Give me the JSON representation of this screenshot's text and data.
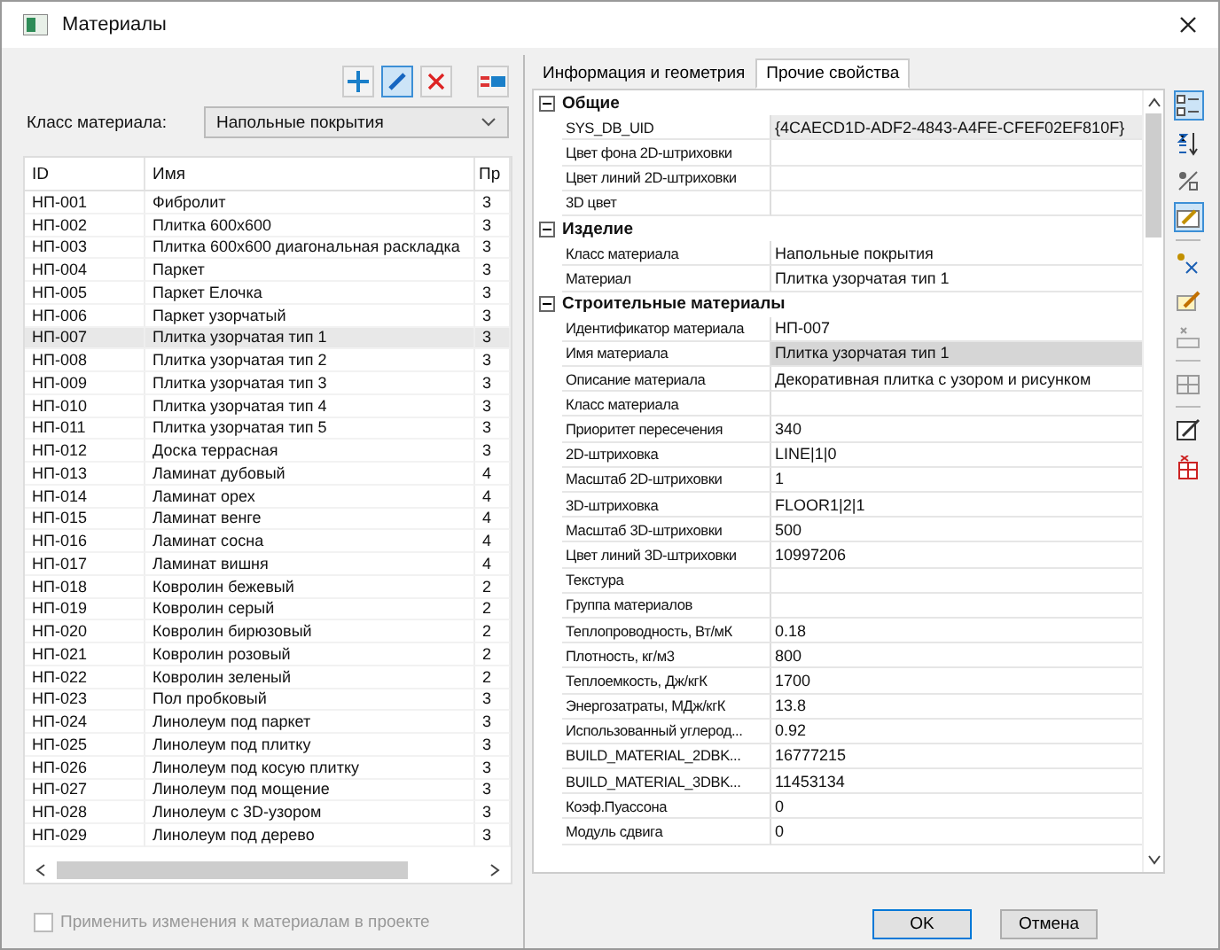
{
  "window": {
    "title": "Материалы"
  },
  "toolbar": [
    {
      "kind": "add",
      "pressed": false
    },
    {
      "kind": "edit",
      "pressed": true
    },
    {
      "kind": "delete",
      "pressed": false
    },
    {
      "kind": "assign",
      "pressed": false
    }
  ],
  "class_filter": {
    "label": "Класс материала:",
    "value": "Напольные покрытия"
  },
  "table": {
    "columns": [
      "ID",
      "Имя",
      "Пр"
    ],
    "rows": [
      {
        "id": "НП-001",
        "name": "Фибролит",
        "column_3": "3",
        "selected": false
      },
      {
        "id": "НП-002",
        "name": "Плитка 600х600",
        "column_3": "3",
        "selected": false
      },
      {
        "id": "НП-003",
        "name": "Плитка 600х600 диагональная раскладка",
        "column_3": "3",
        "selected": false
      },
      {
        "id": "НП-004",
        "name": "Паркет",
        "column_3": "3",
        "selected": false
      },
      {
        "id": "НП-005",
        "name": "Паркет Елочка",
        "column_3": "3",
        "selected": false
      },
      {
        "id": "НП-006",
        "name": "Паркет узорчатый",
        "column_3": "3",
        "selected": false
      },
      {
        "id": "НП-007",
        "name": "Плитка узорчатая тип 1",
        "column_3": "3",
        "selected": true
      },
      {
        "id": "НП-008",
        "name": "Плитка узорчатая тип 2",
        "column_3": "3",
        "selected": false
      },
      {
        "id": "НП-009",
        "name": "Плитка узорчатая тип 3",
        "column_3": "3",
        "selected": false
      },
      {
        "id": "НП-010",
        "name": "Плитка узорчатая тип 4",
        "column_3": "3",
        "selected": false
      },
      {
        "id": "НП-011",
        "name": "Плитка узорчатая тип 5",
        "column_3": "3",
        "selected": false
      },
      {
        "id": "НП-012",
        "name": "Доска террасная",
        "column_3": "3",
        "selected": false
      },
      {
        "id": "НП-013",
        "name": "Ламинат дубовый",
        "column_3": "4",
        "selected": false
      },
      {
        "id": "НП-014",
        "name": "Ламинат орех",
        "column_3": "4",
        "selected": false
      },
      {
        "id": "НП-015",
        "name": "Ламинат венге",
        "column_3": "4",
        "selected": false
      },
      {
        "id": "НП-016",
        "name": "Ламинат сосна",
        "column_3": "4",
        "selected": false
      },
      {
        "id": "НП-017",
        "name": "Ламинат вишня",
        "column_3": "4",
        "selected": false
      },
      {
        "id": "НП-018",
        "name": "Ковролин бежевый",
        "column_3": "2",
        "selected": false
      },
      {
        "id": "НП-019",
        "name": "Ковролин серый",
        "column_3": "2",
        "selected": false
      },
      {
        "id": "НП-020",
        "name": "Ковролин бирюзовый",
        "column_3": "2",
        "selected": false
      },
      {
        "id": "НП-021",
        "name": "Ковролин розовый",
        "column_3": "2",
        "selected": false
      },
      {
        "id": "НП-022",
        "name": "Ковролин зеленый",
        "column_3": "2",
        "selected": false
      },
      {
        "id": "НП-023",
        "name": "Пол пробковый",
        "column_3": "3",
        "selected": false
      },
      {
        "id": "НП-024",
        "name": "Линолеум под паркет",
        "column_3": "3",
        "selected": false
      },
      {
        "id": "НП-025",
        "name": "Линолеум под плитку",
        "column_3": "3",
        "selected": false
      },
      {
        "id": "НП-026",
        "name": "Линолеум под косую плитку",
        "column_3": "3",
        "selected": false
      },
      {
        "id": "НП-027",
        "name": "Линолеум под мощение",
        "column_3": "3",
        "selected": false
      },
      {
        "id": "НП-028",
        "name": "Линолеум с 3D-узором",
        "column_3": "3",
        "selected": false
      },
      {
        "id": "НП-029",
        "name": "Линолеум под дерево",
        "column_3": "3",
        "selected": false
      }
    ]
  },
  "apply_checkbox": {
    "label": "Применить изменения к материалам в проекте",
    "checked": false,
    "disabled": true
  },
  "tabs": [
    {
      "label": "Информация и геометрия",
      "selected": false
    },
    {
      "label": "Прочие свойства",
      "selected": true
    }
  ],
  "property_groups": [
    {
      "title": "Общие",
      "expanded": true,
      "rows": [
        {
          "name": "SYS_DB_UID",
          "value": "{4CAECD1D-ADF2-4843-A4FE-CFEF02EF810F}",
          "readonly": true,
          "selected": false
        },
        {
          "name": "Цвет фона 2D-штриховки",
          "value": "",
          "readonly": false,
          "selected": false
        },
        {
          "name": "Цвет  линий 2D-штриховки",
          "value": "",
          "readonly": false,
          "selected": false
        },
        {
          "name": "3D цвет",
          "value": "",
          "readonly": false,
          "selected": false
        }
      ]
    },
    {
      "title": "Изделие",
      "expanded": true,
      "rows": [
        {
          "name": "Класс материала",
          "value": "Напольные покрытия",
          "readonly": false,
          "selected": false
        },
        {
          "name": "Материал",
          "value": "Плитка узорчатая тип 1",
          "readonly": false,
          "selected": false
        }
      ]
    },
    {
      "title": "Строительные материалы",
      "expanded": true,
      "rows": [
        {
          "name": "Идентификатор материала",
          "value": "НП-007",
          "readonly": false,
          "selected": false
        },
        {
          "name": "Имя материала",
          "value": "Плитка узорчатая тип 1",
          "readonly": false,
          "selected": true
        },
        {
          "name": "Описание материала",
          "value": "Декоративная плитка с узором и рисунком",
          "readonly": false,
          "selected": false
        },
        {
          "name": "Класс материала",
          "value": "",
          "readonly": false,
          "selected": false
        },
        {
          "name": "Приоритет пересечения",
          "value": "340",
          "readonly": false,
          "selected": false
        },
        {
          "name": "2D-штриховка",
          "value": "LINE|1|0",
          "readonly": false,
          "selected": false
        },
        {
          "name": "Масштаб 2D-штриховки",
          "value": "1",
          "readonly": false,
          "selected": false
        },
        {
          "name": "3D-штриховка",
          "value": "FLOOR1|2|1",
          "readonly": false,
          "selected": false
        },
        {
          "name": "Масштаб 3D-штриховки",
          "value": "500",
          "readonly": false,
          "selected": false
        },
        {
          "name": "Цвет  линий 3D-штриховки",
          "value": "10997206",
          "readonly": false,
          "selected": false
        },
        {
          "name": "Текстура",
          "value": "",
          "readonly": false,
          "selected": false
        },
        {
          "name": "Группа материалов",
          "value": "",
          "readonly": false,
          "selected": false
        },
        {
          "name": "Теплопроводность, Вт/мК",
          "value": "0.18",
          "readonly": false,
          "selected": false
        },
        {
          "name": "Плотность, кг/м3",
          "value": "800",
          "readonly": false,
          "selected": false
        },
        {
          "name": "Теплоемкость, Дж/кгК",
          "value": "1700",
          "readonly": false,
          "selected": false
        },
        {
          "name": "Энергозатраты, МДж/кгК",
          "value": "13.8",
          "readonly": false,
          "selected": false
        },
        {
          "name": "Использованный углерод...",
          "value": "0.92",
          "readonly": false,
          "selected": false
        },
        {
          "name": "BUILD_MATERIAL_2DBK...",
          "value": "16777215",
          "readonly": false,
          "selected": false
        },
        {
          "name": "BUILD_MATERIAL_3DBK...",
          "value": "11453134",
          "readonly": false,
          "selected": false
        },
        {
          "name": "Коэф.Пуассона",
          "value": "0",
          "readonly": false,
          "selected": false
        },
        {
          "name": "Модуль сдвига",
          "value": "0",
          "readonly": false,
          "selected": false
        }
      ]
    }
  ],
  "side_toolbar": [
    {
      "kind": "categorized",
      "pressed": true
    },
    {
      "kind": "sort",
      "pressed": false
    },
    {
      "kind": "fraction",
      "pressed": false
    },
    {
      "kind": "edit-grid",
      "pressed": true
    },
    {
      "kind": "separator"
    },
    {
      "kind": "formula",
      "pressed": false
    },
    {
      "kind": "pencil",
      "pressed": false
    },
    {
      "kind": "remove",
      "pressed": false
    },
    {
      "kind": "separator"
    },
    {
      "kind": "table",
      "pressed": false
    },
    {
      "kind": "separator"
    },
    {
      "kind": "sign",
      "pressed": false
    },
    {
      "kind": "delete-table",
      "pressed": false
    }
  ],
  "buttons": [
    {
      "label": "OK",
      "kind": "default"
    },
    {
      "label": "Отмена",
      "kind": "normal"
    }
  ]
}
